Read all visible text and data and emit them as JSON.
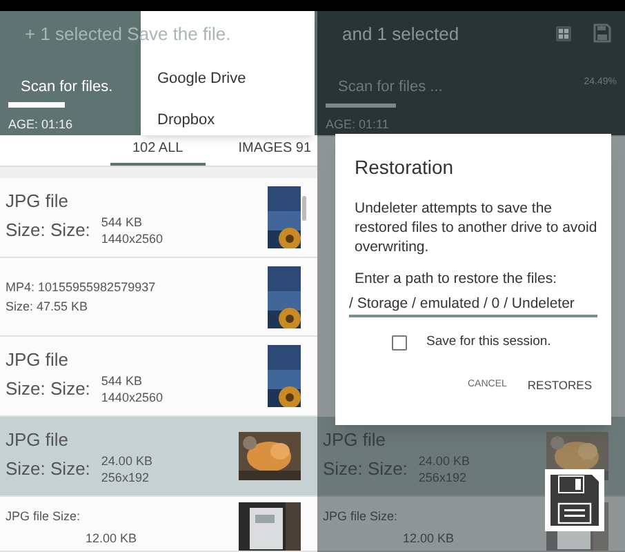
{
  "left_screen": {
    "header": {
      "title": "+ 1 selected Save the file.",
      "scan_label": "Scan for files.",
      "progress": {
        "level": 0.19
      },
      "age": "AGE: 01:16"
    },
    "menu": [
      "Google Drive",
      "Dropbox"
    ],
    "tabs": [
      {
        "label": "102 ALL",
        "selected": true
      },
      {
        "label": "IMAGES 91",
        "selected": false
      }
    ],
    "rows": [
      {
        "kind": "detailed",
        "title": "JPG file",
        "label": "Size: Size:",
        "size": "544 KB",
        "dims": "1440x2560",
        "selected": false
      },
      {
        "kind": "compact",
        "title": "MP4: 10155955982579937",
        "size": "Size: 47.55 KB",
        "selected": false
      },
      {
        "kind": "detailed",
        "title": "JPG file",
        "label": "Size: Size:",
        "size": "544 KB",
        "dims": "1440x2560",
        "selected": false
      },
      {
        "kind": "detailed",
        "title": "JPG file",
        "label": "Size: Size:",
        "size": "24.00 KB",
        "dims": "256x192",
        "selected": true
      },
      {
        "kind": "partial",
        "title": "JPG file Size:",
        "size": "12.00 KB",
        "selected": false
      }
    ]
  },
  "right_screen": {
    "header": {
      "title": "and 1 selected",
      "scan_label": "Scan for files ...",
      "percent": "24.49%",
      "progress": {
        "level": 0.24
      },
      "age": "AGE: 01:11"
    },
    "dialog": {
      "title": "Restoration",
      "message": "Undeleter attempts to save the restored files to another drive to avoid overwriting.",
      "prompt": "Enter a path to restore the files:",
      "path": "/ Storage / emulated / 0 / Undeleter",
      "checkbox": {
        "label": "Save for this session.",
        "checked": false
      },
      "buttons": [
        "CANCEL",
        "RESTORES"
      ]
    },
    "rows": [
      {
        "kind": "detailed",
        "title": "JPG file",
        "label": "Size: Size:",
        "size": "24.00 KB",
        "dims": "256x192",
        "selected": true
      },
      {
        "kind": "partial",
        "title": "JPG file Size:",
        "size": "12.00 KB",
        "selected": false
      }
    ]
  }
}
